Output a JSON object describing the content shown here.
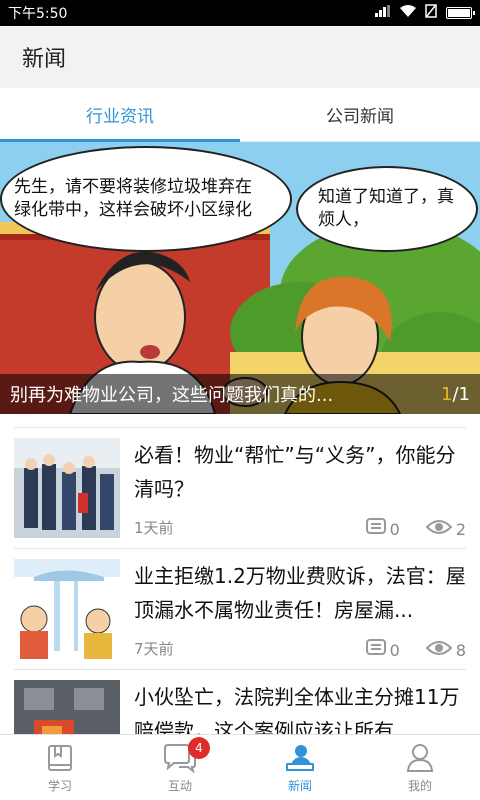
{
  "status_bar": {
    "time": "下午5:50"
  },
  "app_bar": {
    "title": "新闻"
  },
  "tabs": [
    {
      "label": "行业资讯",
      "active": true
    },
    {
      "label": "公司新闻",
      "active": false
    }
  ],
  "banner": {
    "bubble_left": "先生，请不要将装修垃圾堆弃在绿化带中，这样会破坏小区绿化",
    "bubble_right": "知道了知道了，真烦人，",
    "caption": "别再为难物业公司，这些问题我们真的...",
    "pager_current": "1",
    "pager_total": "/1"
  },
  "news": [
    {
      "title": "必看！物业“帮忙”与“义务”，你能分清吗？",
      "time": "1天前",
      "comments": "0",
      "views": "2"
    },
    {
      "title": "业主拒缴1.2万物业费败诉，法官：屋顶漏水不属物业责任！房屋漏...",
      "time": "7天前",
      "comments": "0",
      "views": "8"
    },
    {
      "title": "小伙坠亡，法院判全体业主分摊11万赔偿款，这个案例应该让所有...",
      "time": "",
      "comments": "",
      "views": ""
    }
  ],
  "bottom_nav": [
    {
      "label": "学习",
      "icon": "book-icon",
      "active": false
    },
    {
      "label": "互动",
      "icon": "chat-icon",
      "active": false,
      "badge": "4"
    },
    {
      "label": "新闻",
      "icon": "newsreader-icon",
      "active": true
    },
    {
      "label": "我的",
      "icon": "person-icon",
      "active": false
    }
  ],
  "colors": {
    "accent": "#2f95d7",
    "badge": "#e02b2b",
    "pager_highlight": "#f3b125"
  }
}
